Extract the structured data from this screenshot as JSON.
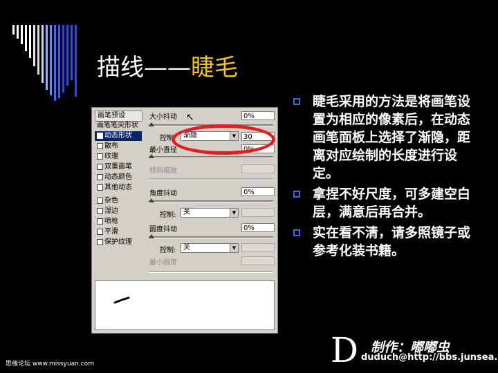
{
  "title": {
    "main": "描线——",
    "highlight": "睫毛"
  },
  "panel": {
    "sidebar": [
      {
        "label": "画笔预设",
        "type": "header"
      },
      {
        "label": "画笔笔尖形状",
        "type": "plain"
      },
      {
        "label": "动态形状",
        "type": "check",
        "selected": true
      },
      {
        "label": "散布",
        "type": "check"
      },
      {
        "label": "纹理",
        "type": "check"
      },
      {
        "label": "双重画笔",
        "type": "check"
      },
      {
        "label": "动态颜色",
        "type": "check"
      },
      {
        "label": "其他动态",
        "type": "check"
      },
      {
        "label": "杂色",
        "type": "check"
      },
      {
        "label": "湿边",
        "type": "check"
      },
      {
        "label": "喷枪",
        "type": "check"
      },
      {
        "label": "平滑",
        "type": "check"
      },
      {
        "label": "保护纹理",
        "type": "check"
      }
    ],
    "size_jitter": {
      "label": "大小抖动",
      "value": "0%"
    },
    "control1": {
      "label": "控制:",
      "option": "渐隐",
      "value": "30"
    },
    "min_diameter": {
      "label": "最小直径",
      "value": "0%"
    },
    "tilt_scale": {
      "label": "倾斜缩放"
    },
    "angle_jitter": {
      "label": "角度抖动",
      "value": "0%"
    },
    "control2": {
      "label": "控制:",
      "option": "关"
    },
    "roundness_jitter": {
      "label": "圆度抖动",
      "value": "0%"
    },
    "control3": {
      "label": "控制:",
      "option": "关"
    },
    "min_roundness": {
      "label": "最小圆度"
    }
  },
  "bullets": [
    "睫毛采用的方法是将画笔设置为相应的像素后，在动态画笔面板上选择了渐隐，距离对应绘制的长度进行设定。",
    "拿捏不好尺度，可多建空白层，满意后再合并。",
    "实在看不清，请多照镜子或参考化装书籍。"
  ],
  "footer": {
    "logo_letter": "D",
    "made_by": "制作：嘟嘟虫",
    "email": "duduch@http://bbs.junsea.com",
    "watermark": "思缘论坛  www.missyuan.com"
  },
  "colors": {
    "accent": "#f0c020",
    "bullet": "#3a6be0",
    "ellipse": "#e02020"
  }
}
